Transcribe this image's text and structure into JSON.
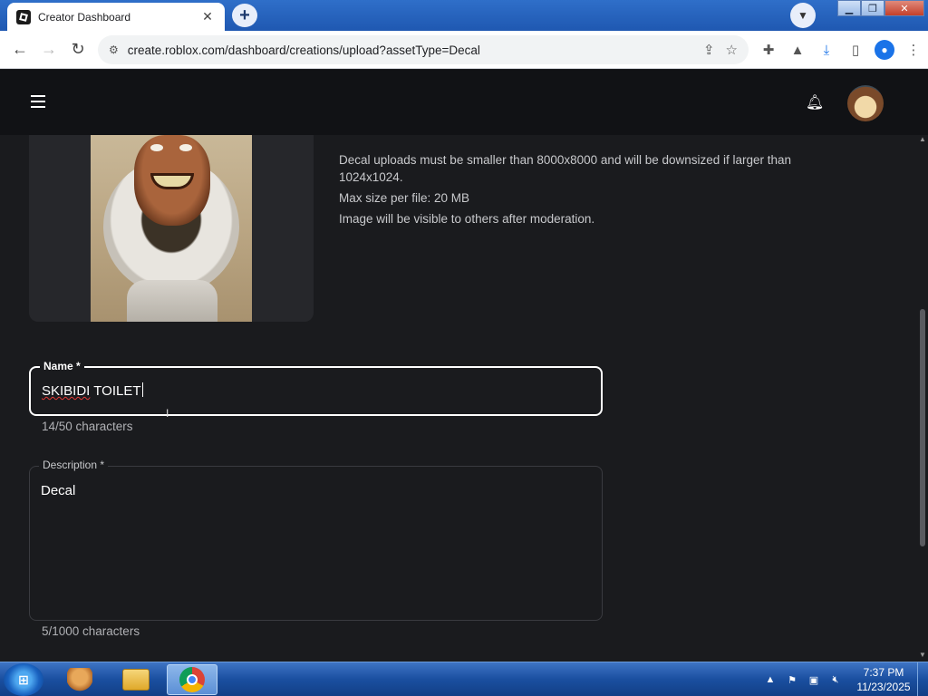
{
  "browser": {
    "tab_title": "Creator Dashboard",
    "tab_close": "✕",
    "new_tab": "+",
    "url": "create.roblox.com/dashboard/creations/upload?assetType=Decal",
    "window_buttons": {
      "minimize": "▁",
      "maximize": "❐",
      "close": "✕"
    }
  },
  "app_header": {
    "menu_icon": "hamburger-menu-icon",
    "notifications_icon": "bell-icon",
    "avatar": "user-avatar"
  },
  "upload": {
    "info_lines": [
      "Decal uploads must be smaller than 8000x8000 and will be downsized if larger than 1024x1024.",
      "Max size per file: 20 MB",
      "Image will be visible to others after moderation."
    ],
    "name_label": "Name *",
    "name_value_misspelled": "SKIBIDI",
    "name_value_rest": " TOILET",
    "name_counter": "14/50 characters",
    "description_label": "Description *",
    "description_value": "Decal",
    "description_counter": "5/1000 characters"
  },
  "taskbar": {
    "start": "⊞",
    "clock_time": "7:37 PM",
    "clock_date": "11/23/2025",
    "tray_expand": "▲"
  },
  "colors": {
    "page_bg": "#1a1b1e",
    "header_bg": "#111215",
    "text": "#ffffff",
    "muted_text": "#c8c9cc"
  }
}
